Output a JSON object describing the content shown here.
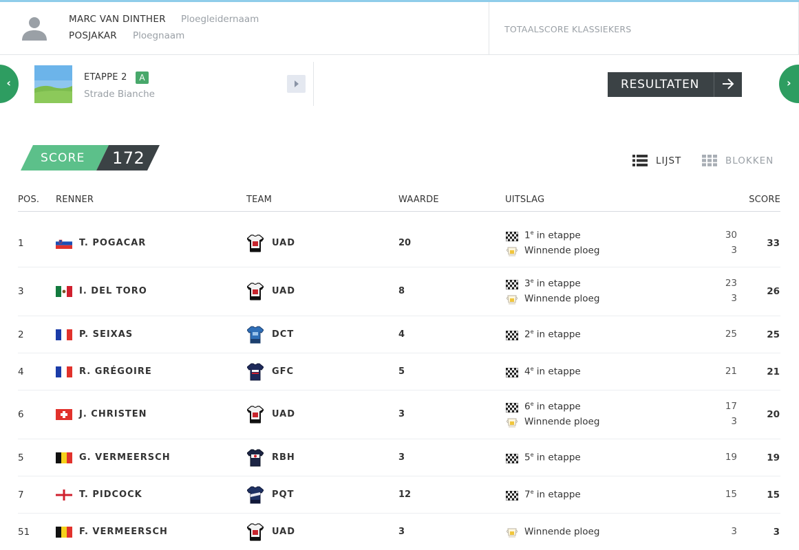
{
  "header": {
    "manager_name": "MARC VAN DINTHER",
    "manager_label": "Ploegleidernaam",
    "team_name": "POSJAKAR",
    "team_label": "Ploegnaam",
    "total_score_label": "TOTAALSCORE KLASSIEKERS"
  },
  "stage": {
    "title": "ETAPPE 2",
    "badge": "A",
    "name": "Strade Bianche",
    "results_button": "RESULTATEN"
  },
  "score": {
    "label": "SCORE",
    "value": "172"
  },
  "views": {
    "list": "LIJST",
    "blocks": "BLOKKEN",
    "active": "list"
  },
  "table": {
    "headers": {
      "pos": "POS.",
      "rider": "RENNER",
      "team": "TEAM",
      "value": "WAARDE",
      "result": "UITSLAG",
      "score": "SCORE"
    },
    "rows": [
      {
        "pos": "1",
        "flag": "slovenia",
        "rider": "T. POGACAR",
        "jersey": "uad",
        "team": "UAD",
        "value": "20",
        "results": [
          {
            "icon": "checkered-flag-icon",
            "text": "1",
            "sup": "e",
            "suffix": " in etappe",
            "points": "30"
          },
          {
            "icon": "cup-icon",
            "text": "Winnende ploeg",
            "sup": "",
            "suffix": "",
            "points": "3"
          }
        ],
        "total": "33"
      },
      {
        "pos": "3",
        "flag": "mexico",
        "rider": "I. DEL TORO",
        "jersey": "uad",
        "team": "UAD",
        "value": "8",
        "results": [
          {
            "icon": "checkered-flag-icon",
            "text": "3",
            "sup": "e",
            "suffix": " in etappe",
            "points": "23"
          },
          {
            "icon": "cup-icon",
            "text": "Winnende ploeg",
            "sup": "",
            "suffix": "",
            "points": "3"
          }
        ],
        "total": "26"
      },
      {
        "pos": "2",
        "flag": "france",
        "rider": "P. SEIXAS",
        "jersey": "dct",
        "team": "DCT",
        "value": "4",
        "results": [
          {
            "icon": "checkered-flag-icon",
            "text": "2",
            "sup": "e",
            "suffix": " in etappe",
            "points": "25"
          }
        ],
        "total": "25"
      },
      {
        "pos": "4",
        "flag": "france",
        "rider": "R. GRÉGOIRE",
        "jersey": "gfc",
        "team": "GFC",
        "value": "5",
        "results": [
          {
            "icon": "checkered-flag-icon",
            "text": "4",
            "sup": "e",
            "suffix": " in etappe",
            "points": "21"
          }
        ],
        "total": "21"
      },
      {
        "pos": "6",
        "flag": "switzerland",
        "rider": "J. CHRISTEN",
        "jersey": "uad",
        "team": "UAD",
        "value": "3",
        "results": [
          {
            "icon": "checkered-flag-icon",
            "text": "6",
            "sup": "e",
            "suffix": " in etappe",
            "points": "17"
          },
          {
            "icon": "cup-icon",
            "text": "Winnende ploeg",
            "sup": "",
            "suffix": "",
            "points": "3"
          }
        ],
        "total": "20"
      },
      {
        "pos": "5",
        "flag": "belgium",
        "rider": "G. VERMEERSCH",
        "jersey": "rbh",
        "team": "RBH",
        "value": "3",
        "results": [
          {
            "icon": "checkered-flag-icon",
            "text": "5",
            "sup": "e",
            "suffix": " in etappe",
            "points": "19"
          }
        ],
        "total": "19"
      },
      {
        "pos": "7",
        "flag": "england",
        "rider": "T. PIDCOCK",
        "jersey": "pqt",
        "team": "PQT",
        "value": "12",
        "results": [
          {
            "icon": "checkered-flag-icon",
            "text": "7",
            "sup": "e",
            "suffix": " in etappe",
            "points": "15"
          }
        ],
        "total": "15"
      },
      {
        "pos": "51",
        "flag": "belgium",
        "rider": "F. VERMEERSCH",
        "jersey": "uad",
        "team": "UAD",
        "value": "3",
        "results": [
          {
            "icon": "cup-icon",
            "text": "Winnende ploeg",
            "sup": "",
            "suffix": "",
            "points": "3"
          }
        ],
        "total": "3"
      }
    ]
  },
  "colors": {
    "accent_green": "#2e9d61",
    "badge_green": "#48a86b",
    "score_green": "#5cc08a",
    "dark": "#3b4245"
  }
}
